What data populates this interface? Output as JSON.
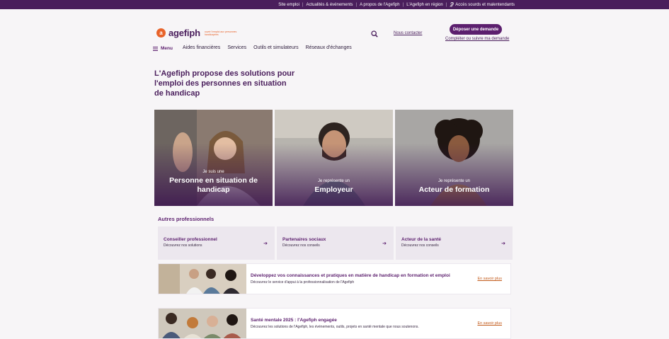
{
  "topbar": {
    "links": [
      "Site emploi",
      "Actualités & événements",
      "A propos de l'Agefiph",
      "L'Agefiph en région",
      "Accès sourds et malentendants"
    ]
  },
  "header": {
    "logo_word": "agefiph",
    "logo_tag": "ouvrir l'emploi aux personnes handicapées",
    "contact": "Nous contacter",
    "cta": "Déposer une demande",
    "follow": "Compléter ou suivre ma demande"
  },
  "nav": {
    "menu": "Menu",
    "items": [
      "Aides financières",
      "Services",
      "Outils et simulateurs",
      "Réseaux d'échanges"
    ]
  },
  "hero": {
    "title": "L'Agefiph propose des solutions pour l'emploi des personnes en situation de handicap"
  },
  "cards": [
    {
      "pre": "Je suis une",
      "main": "Personne en situation de handicap"
    },
    {
      "pre": "Je représente un",
      "main": "Employeur"
    },
    {
      "pre": "Je représente un",
      "main": "Acteur de formation"
    }
  ],
  "others": {
    "title": "Autres professionnels",
    "items": [
      {
        "t": "Conseiller professionnel",
        "s": "Découvrez nos solutions"
      },
      {
        "t": "Partenaires sociaux",
        "s": "Découvrez nos conseils"
      },
      {
        "t": "Acteur de la santé",
        "s": "Découvrez nos conseils"
      }
    ]
  },
  "promos": [
    {
      "t": "Développez vos connaissances et pratiques en matière de handicap en formation et emploi",
      "s": "Découvrez le service d'appui à la professionnalisation de l'Agefiph",
      "more": "En savoir plus"
    },
    {
      "t": "Santé mentale 2025 : l'Agefiph engagée",
      "s": "Découvrez les solutions de l'Agefiph, les événements, outils, projets en santé mentale que nous soutenons.",
      "more": "En savoir plus"
    }
  ]
}
